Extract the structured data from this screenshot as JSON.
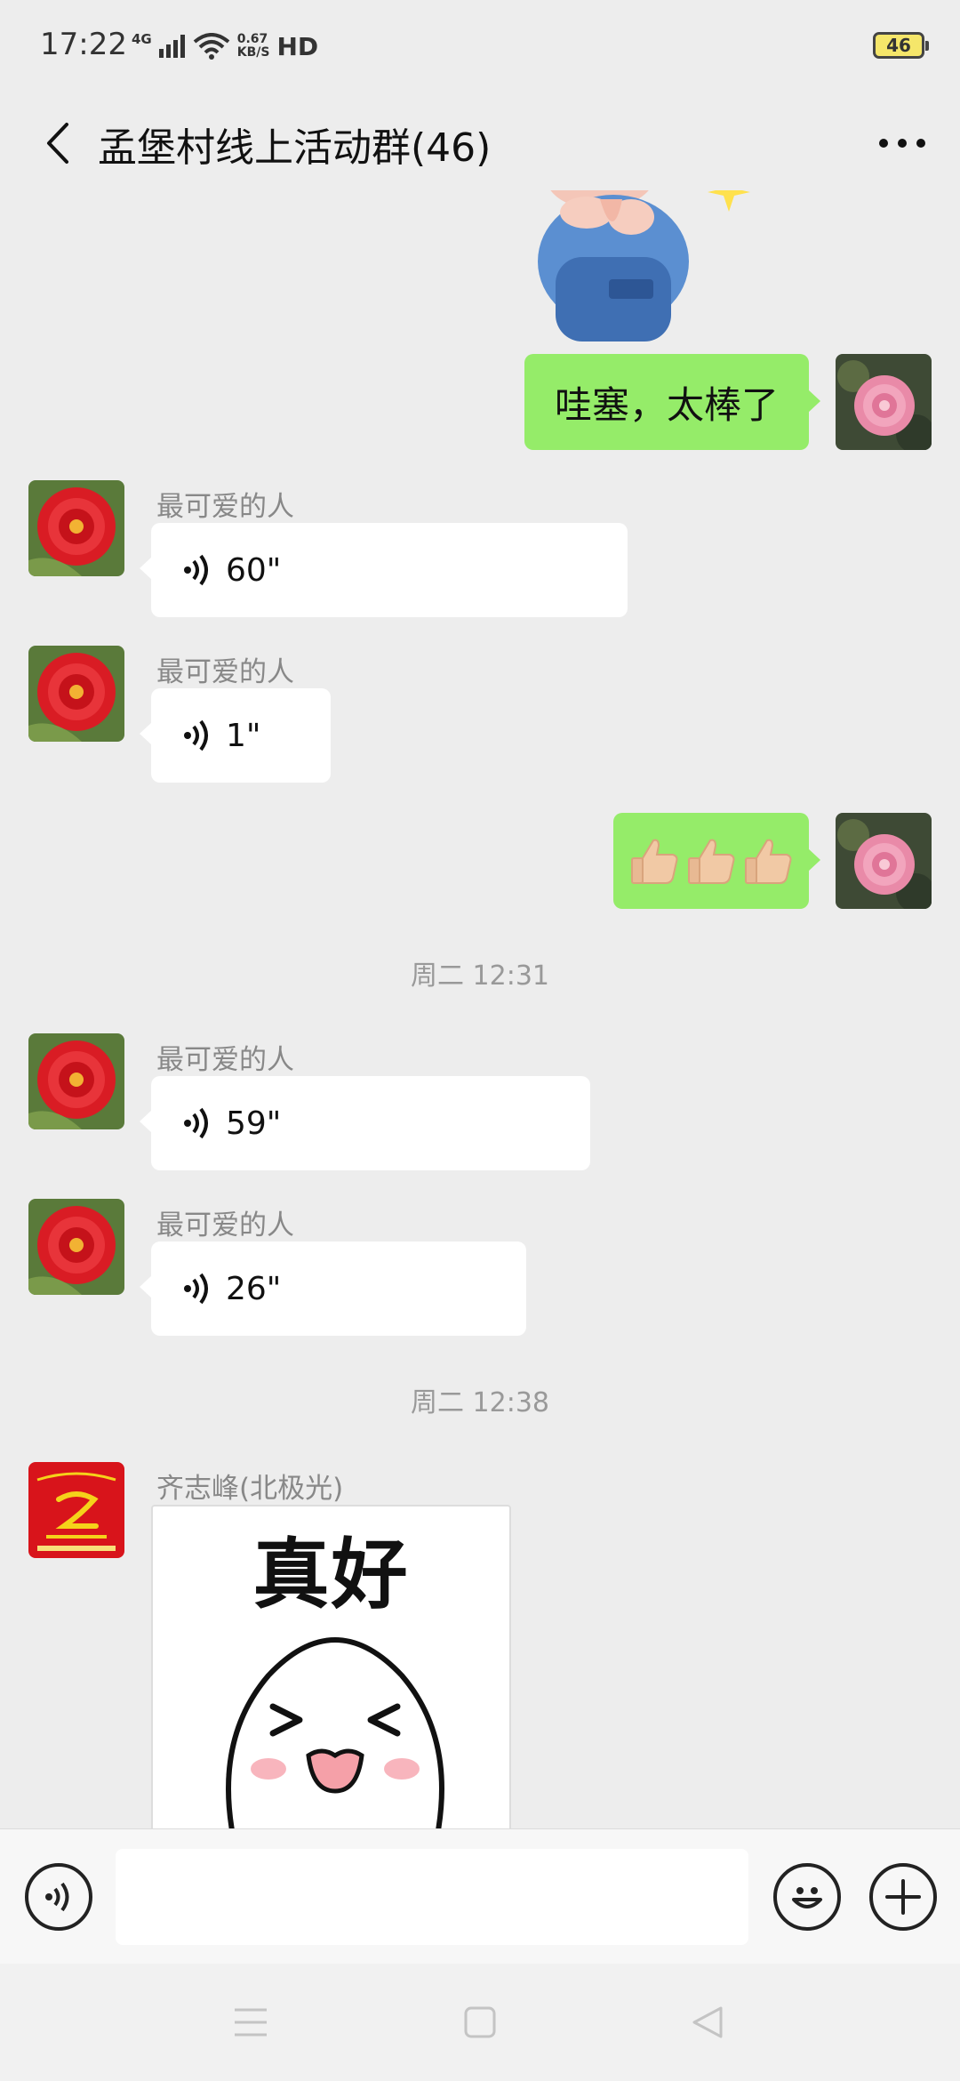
{
  "status_bar": {
    "time": "17:22",
    "network": "4G",
    "speed_value": "0.67",
    "speed_unit": "KB/S",
    "hd": "HD",
    "battery": "46"
  },
  "header": {
    "title": "孟堡村线上活动群(46)",
    "back_icon": "chevron-left-icon",
    "more_icon": "more-dots-icon"
  },
  "messages": [
    {
      "type": "sticker",
      "from": "me",
      "description_icon": "cartoon-pig-sticker"
    },
    {
      "type": "text",
      "from": "me",
      "text": "哇塞，太棒了"
    },
    {
      "type": "voice",
      "from": "other",
      "sender": "最可爱的人",
      "duration": "60\""
    },
    {
      "type": "voice",
      "from": "other",
      "sender": "最可爱的人",
      "duration": "1\""
    },
    {
      "type": "emoji",
      "from": "me",
      "emoji": "👍🏼👍🏼👍🏼"
    },
    {
      "type": "time",
      "text": "周二 12:31"
    },
    {
      "type": "voice",
      "from": "other",
      "sender": "最可爱的人",
      "duration": "59\""
    },
    {
      "type": "voice",
      "from": "other",
      "sender": "最可爱的人",
      "duration": "26\""
    },
    {
      "type": "time",
      "text": "周二 12:38"
    },
    {
      "type": "sticker",
      "from": "other",
      "sender": "齐志峰(北极光)",
      "sticker_text": "真好"
    }
  ],
  "input_bar": {
    "placeholder": "",
    "voice_icon": "voice-input-icon",
    "emoji_icon": "emoji-icon",
    "plus_icon": "plus-icon"
  },
  "colors": {
    "background": "#ededed",
    "bubble_out": "#95ec69",
    "bubble_in": "#ffffff",
    "accent_logo_red": "#d8141b"
  }
}
